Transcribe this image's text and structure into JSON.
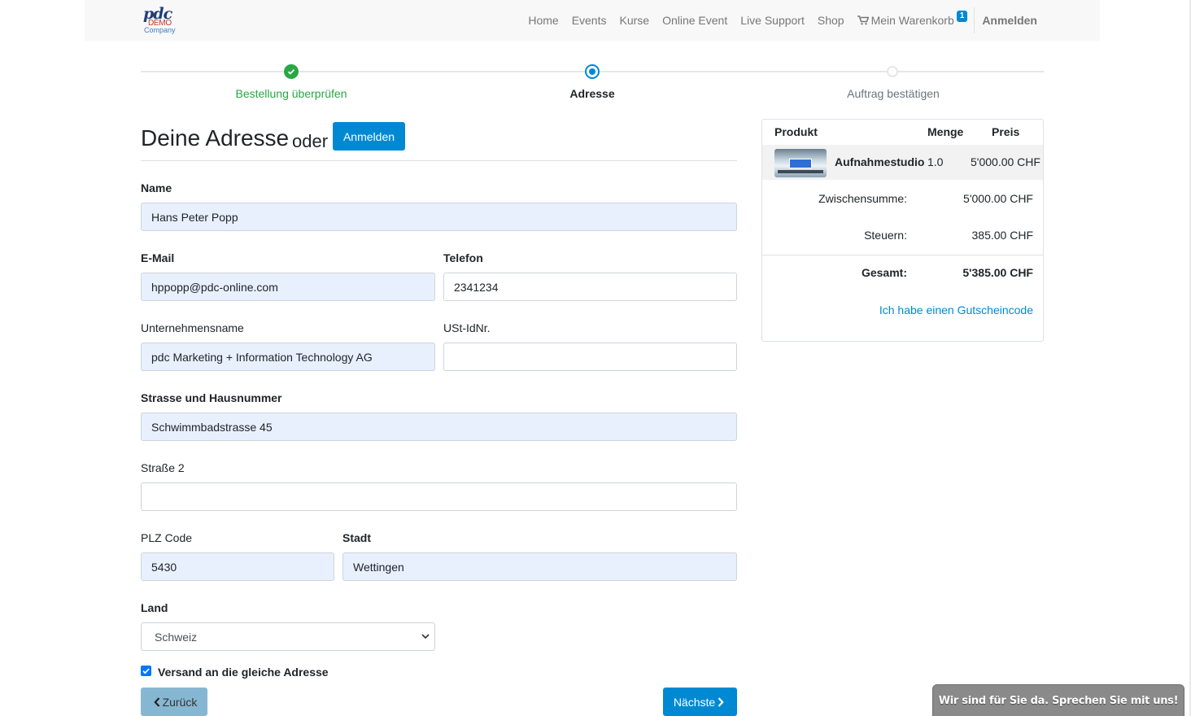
{
  "logo": {
    "line1": "pdc",
    "line2": "DEMO",
    "line3": "Company"
  },
  "nav": {
    "links": [
      "Home",
      "Events",
      "Kurse",
      "Online Event",
      "Live Support",
      "Shop"
    ],
    "cart_label": "Mein Warenkorb",
    "cart_count": "1",
    "login": "Anmelden"
  },
  "wizard": {
    "steps": [
      {
        "label": "Bestellung überprüfen",
        "state": "done"
      },
      {
        "label": "Adresse",
        "state": "active"
      },
      {
        "label": "Auftrag bestätigen",
        "state": "todo"
      }
    ]
  },
  "heading": {
    "title": "Deine Adresse",
    "or": "oder",
    "login_button": "Anmelden"
  },
  "form": {
    "name": {
      "label": "Name",
      "value": "Hans Peter Popp"
    },
    "email": {
      "label": "E-Mail",
      "value": "hppopp@pdc-online.com"
    },
    "phone": {
      "label": "Telefon",
      "value": "2341234"
    },
    "company": {
      "label": "Unternehmensname",
      "value": "pdc Marketing + Information Technology AG"
    },
    "vat": {
      "label": "USt-IdNr.",
      "value": ""
    },
    "street": {
      "label": "Strasse und Hausnummer",
      "value": "Schwimmbadstrasse 45"
    },
    "street2": {
      "label": "Straße 2",
      "value": ""
    },
    "zip": {
      "label": "PLZ Code",
      "value": "5430"
    },
    "city": {
      "label": "Stadt",
      "value": "Wettingen"
    },
    "country": {
      "label": "Land",
      "value": "Schweiz"
    },
    "same_shipping": {
      "label": "Versand an die gleiche Adresse",
      "checked": true
    },
    "back_button": "Zurück",
    "next_button": "Nächste"
  },
  "summary": {
    "headers": {
      "product": "Produkt",
      "qty": "Menge",
      "price": "Preis"
    },
    "item": {
      "name": "Aufnahmestudio",
      "qty": "1.0",
      "price": "5'000.00 CHF"
    },
    "subtotal": {
      "label": "Zwischensumme:",
      "value": "5'000.00 CHF"
    },
    "taxes": {
      "label": "Steuern:",
      "value": "385.00 CHF"
    },
    "total": {
      "label": "Gesamt:",
      "value": "5'385.00 CHF"
    },
    "voucher_link": "Ich habe einen Gutscheincode"
  },
  "chat": {
    "label": "Wir sind für Sie da. Sprechen Sie mit uns!"
  },
  "colors": {
    "primary": "#0089d3",
    "success": "#28a745",
    "autofill": "#e8f0fe"
  }
}
